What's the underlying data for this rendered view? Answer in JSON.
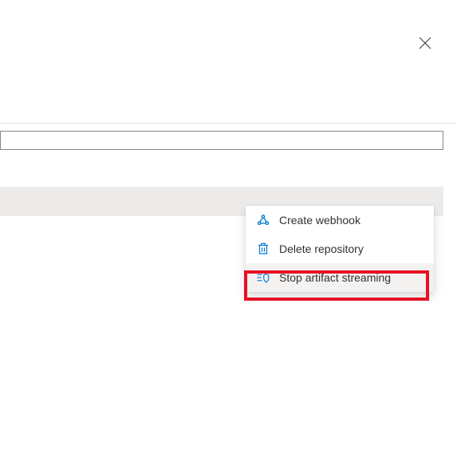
{
  "close": {
    "label": "Close"
  },
  "contextMenu": {
    "items": [
      {
        "label": "Create webhook",
        "iconName": "webhook-icon"
      },
      {
        "label": "Delete repository",
        "iconName": "trash-icon"
      },
      {
        "label": "Stop artifact streaming",
        "iconName": "shield-icon"
      }
    ]
  },
  "colors": {
    "iconBlue": "#0078d4",
    "highlightRed": "#e81123",
    "grayBar": "#edebe9"
  }
}
